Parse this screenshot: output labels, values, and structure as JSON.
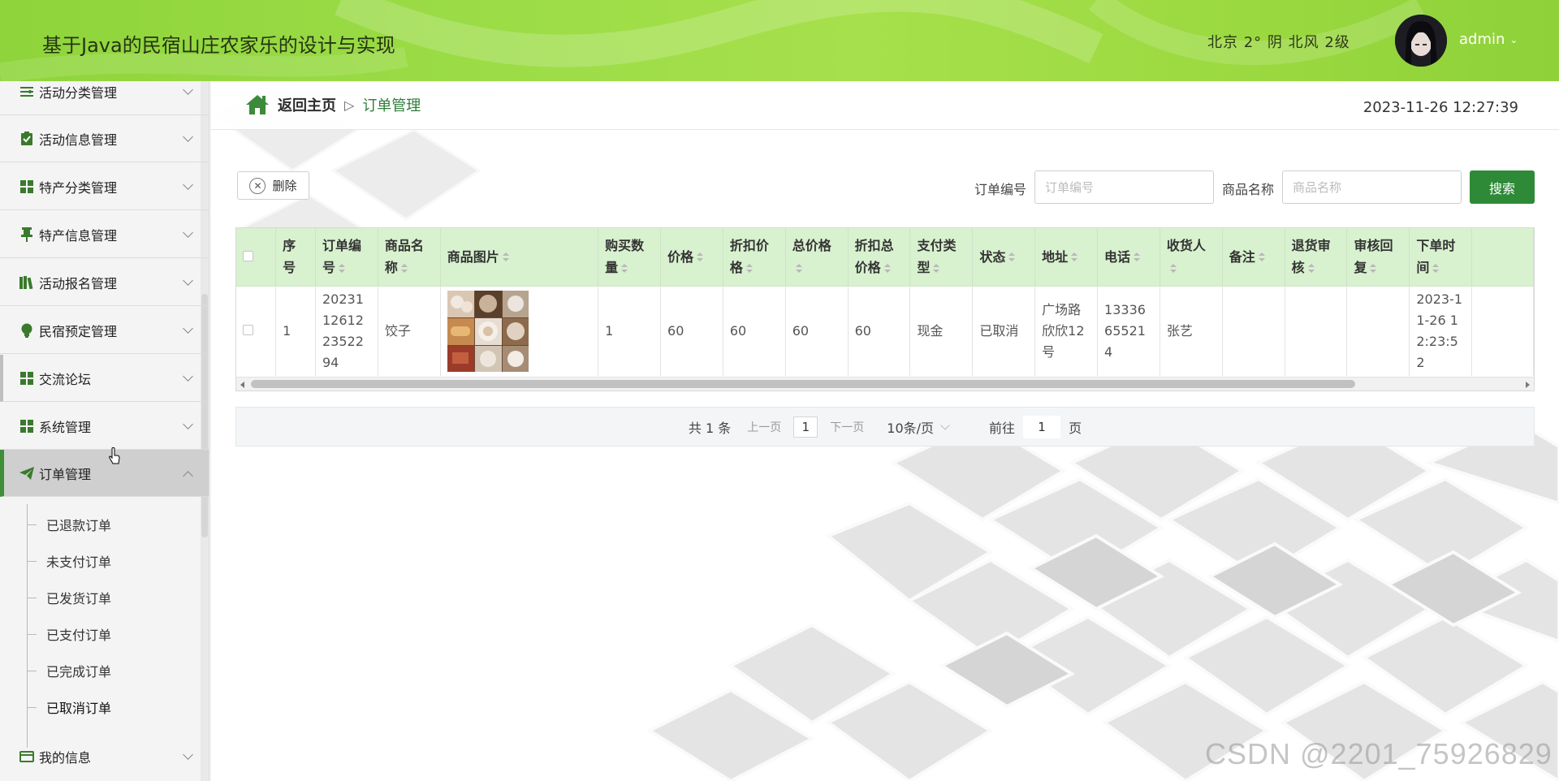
{
  "header": {
    "title": "基于Java的民宿山庄农家乐的设计与实现",
    "weather": "北京  2°  阴  北风  2级",
    "username": "admin"
  },
  "sidebar": {
    "items": [
      {
        "label": "活动分类管理",
        "icon": "list-icon"
      },
      {
        "label": "活动信息管理",
        "icon": "clipboard-check-icon"
      },
      {
        "label": "特产分类管理",
        "icon": "grid-icon"
      },
      {
        "label": "特产信息管理",
        "icon": "pin-icon"
      },
      {
        "label": "活动报名管理",
        "icon": "books-icon"
      },
      {
        "label": "民宿预定管理",
        "icon": "bulb-icon"
      },
      {
        "label": "交流论坛",
        "icon": "grid-icon"
      },
      {
        "label": "系统管理",
        "icon": "grid-icon"
      },
      {
        "label": "订单管理",
        "icon": "send-icon"
      },
      {
        "label": "我的信息",
        "icon": "card-icon"
      }
    ],
    "order_submenu": [
      "已退款订单",
      "未支付订单",
      "已发货订单",
      "已支付订单",
      "已完成订单",
      "已取消订单"
    ]
  },
  "breadcrumb": {
    "home": "返回主页",
    "separator": "▷",
    "current": "订单管理"
  },
  "clock": "2023-11-26 12:27:39",
  "toolbar": {
    "delete_label": "删除",
    "order_no_label": "订单编号",
    "order_no_placeholder": "订单编号",
    "product_label": "商品名称",
    "product_placeholder": "商品名称",
    "search_label": "搜索"
  },
  "table": {
    "columns": [
      "序号",
      "订单编号",
      "商品名称",
      "商品图片",
      "购买数量",
      "价格",
      "折扣价格",
      "总价格",
      "折扣总价格",
      "支付类型",
      "状态",
      "地址",
      "电话",
      "收货人",
      "备注",
      "退货审核",
      "审核回复",
      "下单时间"
    ],
    "rows": [
      {
        "index": "1",
        "order_no": "20231126122352294",
        "product": "饺子",
        "qty": "1",
        "price": "60",
        "discount_price": "60",
        "total": "60",
        "discount_total": "60",
        "pay_type": "现金",
        "status": "已取消",
        "address": "广场路欣欣12号",
        "phone": "13336655214",
        "receiver": "张艺",
        "remark": "",
        "return_review": "",
        "review_reply": "",
        "order_time": "2023-11-26 12:23:52"
      }
    ]
  },
  "pager": {
    "total": "共 1 条",
    "prev": "上一页",
    "page": "1",
    "next": "下一页",
    "page_size": "10条/页",
    "goto_prefix": "前往",
    "goto_value": "1",
    "goto_suffix": "页"
  },
  "watermark": "CSDN @2201_75926829",
  "colors": {
    "header_green": "#9bdc46",
    "accent_green": "#2f8a38",
    "table_header": "#d8f1cf"
  }
}
